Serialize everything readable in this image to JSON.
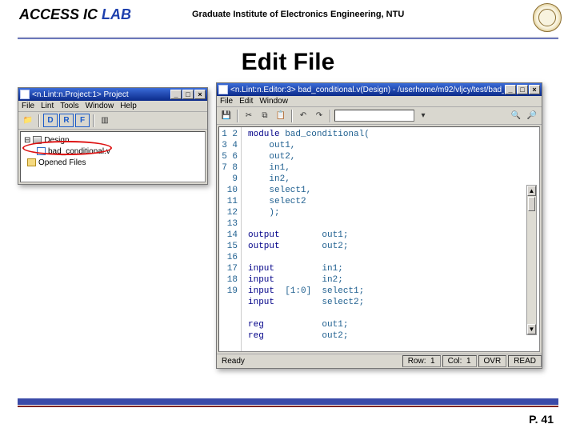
{
  "header": {
    "lab_prefix": "ACCESS IC ",
    "lab_suffix": "LAB",
    "institute": "Graduate Institute of Electronics Engineering, NTU"
  },
  "page_title": "Edit File",
  "project_win": {
    "title": "<n.Lint:n.Project:1> Project",
    "menus": [
      "File",
      "Lint",
      "Tools",
      "Window",
      "Help"
    ],
    "toolbar_letters": [
      "D",
      "R",
      "F"
    ],
    "tree": {
      "root": "Design",
      "file": "bad_conditional.v",
      "opened": "Opened Files"
    }
  },
  "editor_win": {
    "title": "<n.Lint:n.Editor:3> bad_conditional.v(Design) - /userhome/m92/vljcy/test/bad_co...",
    "menus": [
      "File",
      "Edit",
      "Window"
    ],
    "code_lines": [
      {
        "n": 1,
        "t": "module bad_conditional("
      },
      {
        "n": 2,
        "t": "    out1,"
      },
      {
        "n": 3,
        "t": "    out2,"
      },
      {
        "n": 4,
        "t": "    in1,"
      },
      {
        "n": 5,
        "t": "    in2,"
      },
      {
        "n": 6,
        "t": "    select1,"
      },
      {
        "n": 7,
        "t": "    select2"
      },
      {
        "n": 8,
        "t": "    );"
      },
      {
        "n": 9,
        "t": ""
      },
      {
        "n": 10,
        "t": "output        out1;"
      },
      {
        "n": 11,
        "t": "output        out2;"
      },
      {
        "n": 12,
        "t": ""
      },
      {
        "n": 13,
        "t": "input         in1;"
      },
      {
        "n": 14,
        "t": "input         in2;"
      },
      {
        "n": 15,
        "t": "input  [1:0]  select1;"
      },
      {
        "n": 16,
        "t": "input         select2;"
      },
      {
        "n": 17,
        "t": ""
      },
      {
        "n": 18,
        "t": "reg           out1;"
      },
      {
        "n": 19,
        "t": "reg           out2;"
      }
    ],
    "status": {
      "ready": "Ready",
      "row_label": "Row:",
      "row_val": "1",
      "col_label": "Col:",
      "col_val": "1",
      "ovr": "OVR",
      "read": "READ"
    }
  },
  "page_number": "P. 41"
}
